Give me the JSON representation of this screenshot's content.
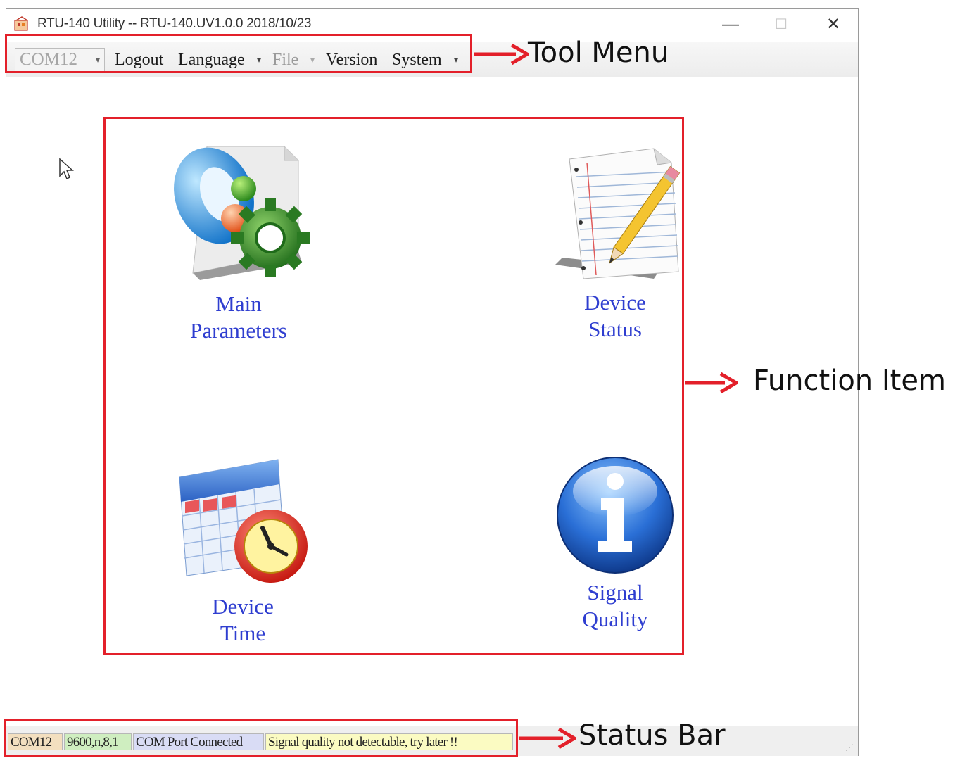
{
  "window": {
    "title": "RTU-140 Utility -- RTU-140.UV1.0.0 2018/10/23",
    "minimize": "—",
    "maximize": "☐",
    "close": "✕"
  },
  "toolbar": {
    "com_port": "COM12",
    "logout": "Logout",
    "language": "Language",
    "file": "File",
    "version": "Version",
    "system": "System"
  },
  "functions": {
    "main_parameters": {
      "line1": "Main",
      "line2": "Parameters",
      "icon": "main-parameters-gear-icon"
    },
    "device_status": {
      "line1": "Device",
      "line2": "Status",
      "icon": "notepad-pencil-icon"
    },
    "device_time": {
      "line1": "Device",
      "line2": "Time",
      "icon": "calendar-clock-icon"
    },
    "signal_quality": {
      "line1": "Signal",
      "line2": "Quality",
      "icon": "info-icon"
    }
  },
  "status_bar": {
    "port": "COM12",
    "settings": "9600,n,8,1",
    "connection": "COM Port Connected",
    "message": "Signal quality not detectable, try later !!",
    "colors": {
      "port": "#f3dfbf",
      "settings": "#cfeec0",
      "connection": "#d9dcf5",
      "message": "#fbfbc2"
    }
  },
  "annotations": {
    "tool_menu": "Tool Menu",
    "function_item": "Function Item",
    "status_bar": "Status Bar",
    "color": "#e3202a"
  }
}
